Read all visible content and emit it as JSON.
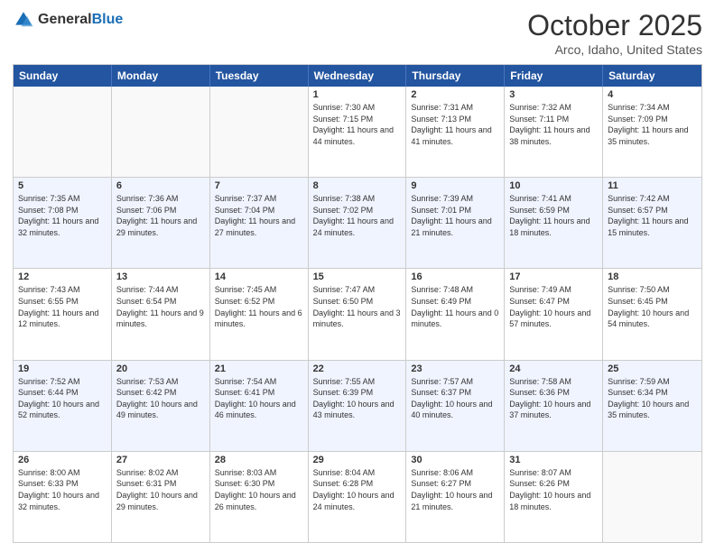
{
  "header": {
    "logo_line1": "General",
    "logo_line2": "Blue",
    "month": "October 2025",
    "location": "Arco, Idaho, United States"
  },
  "weekdays": [
    "Sunday",
    "Monday",
    "Tuesday",
    "Wednesday",
    "Thursday",
    "Friday",
    "Saturday"
  ],
  "rows": [
    {
      "alt": false,
      "cells": [
        {
          "day": "",
          "sunrise": "",
          "sunset": "",
          "daylight": ""
        },
        {
          "day": "",
          "sunrise": "",
          "sunset": "",
          "daylight": ""
        },
        {
          "day": "",
          "sunrise": "",
          "sunset": "",
          "daylight": ""
        },
        {
          "day": "1",
          "sunrise": "Sunrise: 7:30 AM",
          "sunset": "Sunset: 7:15 PM",
          "daylight": "Daylight: 11 hours and 44 minutes."
        },
        {
          "day": "2",
          "sunrise": "Sunrise: 7:31 AM",
          "sunset": "Sunset: 7:13 PM",
          "daylight": "Daylight: 11 hours and 41 minutes."
        },
        {
          "day": "3",
          "sunrise": "Sunrise: 7:32 AM",
          "sunset": "Sunset: 7:11 PM",
          "daylight": "Daylight: 11 hours and 38 minutes."
        },
        {
          "day": "4",
          "sunrise": "Sunrise: 7:34 AM",
          "sunset": "Sunset: 7:09 PM",
          "daylight": "Daylight: 11 hours and 35 minutes."
        }
      ]
    },
    {
      "alt": true,
      "cells": [
        {
          "day": "5",
          "sunrise": "Sunrise: 7:35 AM",
          "sunset": "Sunset: 7:08 PM",
          "daylight": "Daylight: 11 hours and 32 minutes."
        },
        {
          "day": "6",
          "sunrise": "Sunrise: 7:36 AM",
          "sunset": "Sunset: 7:06 PM",
          "daylight": "Daylight: 11 hours and 29 minutes."
        },
        {
          "day": "7",
          "sunrise": "Sunrise: 7:37 AM",
          "sunset": "Sunset: 7:04 PM",
          "daylight": "Daylight: 11 hours and 27 minutes."
        },
        {
          "day": "8",
          "sunrise": "Sunrise: 7:38 AM",
          "sunset": "Sunset: 7:02 PM",
          "daylight": "Daylight: 11 hours and 24 minutes."
        },
        {
          "day": "9",
          "sunrise": "Sunrise: 7:39 AM",
          "sunset": "Sunset: 7:01 PM",
          "daylight": "Daylight: 11 hours and 21 minutes."
        },
        {
          "day": "10",
          "sunrise": "Sunrise: 7:41 AM",
          "sunset": "Sunset: 6:59 PM",
          "daylight": "Daylight: 11 hours and 18 minutes."
        },
        {
          "day": "11",
          "sunrise": "Sunrise: 7:42 AM",
          "sunset": "Sunset: 6:57 PM",
          "daylight": "Daylight: 11 hours and 15 minutes."
        }
      ]
    },
    {
      "alt": false,
      "cells": [
        {
          "day": "12",
          "sunrise": "Sunrise: 7:43 AM",
          "sunset": "Sunset: 6:55 PM",
          "daylight": "Daylight: 11 hours and 12 minutes."
        },
        {
          "day": "13",
          "sunrise": "Sunrise: 7:44 AM",
          "sunset": "Sunset: 6:54 PM",
          "daylight": "Daylight: 11 hours and 9 minutes."
        },
        {
          "day": "14",
          "sunrise": "Sunrise: 7:45 AM",
          "sunset": "Sunset: 6:52 PM",
          "daylight": "Daylight: 11 hours and 6 minutes."
        },
        {
          "day": "15",
          "sunrise": "Sunrise: 7:47 AM",
          "sunset": "Sunset: 6:50 PM",
          "daylight": "Daylight: 11 hours and 3 minutes."
        },
        {
          "day": "16",
          "sunrise": "Sunrise: 7:48 AM",
          "sunset": "Sunset: 6:49 PM",
          "daylight": "Daylight: 11 hours and 0 minutes."
        },
        {
          "day": "17",
          "sunrise": "Sunrise: 7:49 AM",
          "sunset": "Sunset: 6:47 PM",
          "daylight": "Daylight: 10 hours and 57 minutes."
        },
        {
          "day": "18",
          "sunrise": "Sunrise: 7:50 AM",
          "sunset": "Sunset: 6:45 PM",
          "daylight": "Daylight: 10 hours and 54 minutes."
        }
      ]
    },
    {
      "alt": true,
      "cells": [
        {
          "day": "19",
          "sunrise": "Sunrise: 7:52 AM",
          "sunset": "Sunset: 6:44 PM",
          "daylight": "Daylight: 10 hours and 52 minutes."
        },
        {
          "day": "20",
          "sunrise": "Sunrise: 7:53 AM",
          "sunset": "Sunset: 6:42 PM",
          "daylight": "Daylight: 10 hours and 49 minutes."
        },
        {
          "day": "21",
          "sunrise": "Sunrise: 7:54 AM",
          "sunset": "Sunset: 6:41 PM",
          "daylight": "Daylight: 10 hours and 46 minutes."
        },
        {
          "day": "22",
          "sunrise": "Sunrise: 7:55 AM",
          "sunset": "Sunset: 6:39 PM",
          "daylight": "Daylight: 10 hours and 43 minutes."
        },
        {
          "day": "23",
          "sunrise": "Sunrise: 7:57 AM",
          "sunset": "Sunset: 6:37 PM",
          "daylight": "Daylight: 10 hours and 40 minutes."
        },
        {
          "day": "24",
          "sunrise": "Sunrise: 7:58 AM",
          "sunset": "Sunset: 6:36 PM",
          "daylight": "Daylight: 10 hours and 37 minutes."
        },
        {
          "day": "25",
          "sunrise": "Sunrise: 7:59 AM",
          "sunset": "Sunset: 6:34 PM",
          "daylight": "Daylight: 10 hours and 35 minutes."
        }
      ]
    },
    {
      "alt": false,
      "cells": [
        {
          "day": "26",
          "sunrise": "Sunrise: 8:00 AM",
          "sunset": "Sunset: 6:33 PM",
          "daylight": "Daylight: 10 hours and 32 minutes."
        },
        {
          "day": "27",
          "sunrise": "Sunrise: 8:02 AM",
          "sunset": "Sunset: 6:31 PM",
          "daylight": "Daylight: 10 hours and 29 minutes."
        },
        {
          "day": "28",
          "sunrise": "Sunrise: 8:03 AM",
          "sunset": "Sunset: 6:30 PM",
          "daylight": "Daylight: 10 hours and 26 minutes."
        },
        {
          "day": "29",
          "sunrise": "Sunrise: 8:04 AM",
          "sunset": "Sunset: 6:28 PM",
          "daylight": "Daylight: 10 hours and 24 minutes."
        },
        {
          "day": "30",
          "sunrise": "Sunrise: 8:06 AM",
          "sunset": "Sunset: 6:27 PM",
          "daylight": "Daylight: 10 hours and 21 minutes."
        },
        {
          "day": "31",
          "sunrise": "Sunrise: 8:07 AM",
          "sunset": "Sunset: 6:26 PM",
          "daylight": "Daylight: 10 hours and 18 minutes."
        },
        {
          "day": "",
          "sunrise": "",
          "sunset": "",
          "daylight": ""
        }
      ]
    }
  ]
}
